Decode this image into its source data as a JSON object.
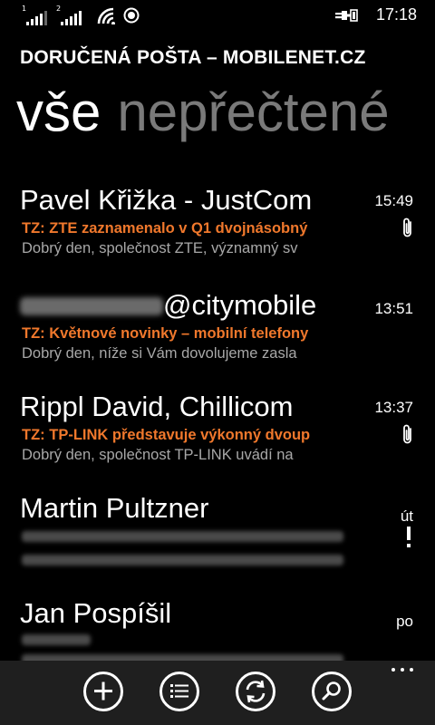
{
  "status_bar": {
    "sim1_label": "1",
    "sim2_label": "2",
    "time": "17:18",
    "icons": [
      "signal-bars-icon",
      "signal-bars-icon",
      "wifi-icon",
      "internet-sharing-icon",
      "battery-charging-icon"
    ]
  },
  "header": {
    "account_title": "DORUČENÁ POŠTA – MOBILENET.CZ",
    "pivot_active": "vše",
    "pivot_next": "nepřečtené"
  },
  "colors": {
    "accent": "#f0782c",
    "background": "#000000",
    "preview_text": "#a8a8a8",
    "inactive_pivot": "#7a7a7a",
    "app_bar": "#1f1f1f"
  },
  "messages": [
    {
      "sender": "Pavel Křižka - JustCom",
      "subject": "TZ: ZTE zaznamenalo v Q1 dvojnásobný",
      "preview": "Dobrý den, společnost ZTE, významný sv",
      "time": "15:49",
      "attachment": true,
      "flag": false
    },
    {
      "sender": "@citymobile",
      "subject": "TZ: Květnové novinky – mobilní telefony",
      "preview": "Dobrý den, níže si Vám dovolujeme zasla",
      "time": "13:51",
      "attachment": false,
      "flag": false
    },
    {
      "sender": "Rippl David, Chillicom",
      "subject": "TZ: TP-LINK představuje výkonný dvoup",
      "preview": "Dobrý den, společnost TP-LINK uvádí na",
      "time": "13:37",
      "attachment": true,
      "flag": false
    },
    {
      "sender": "Martin Pultzner",
      "time": "út",
      "attachment": false,
      "flag": true
    },
    {
      "sender": "Jan Pospíšil",
      "time": "po",
      "attachment": false,
      "flag": false
    }
  ],
  "app_bar": {
    "buttons": [
      "new-mail",
      "select",
      "sync",
      "search"
    ],
    "more_icon": "ellipsis-icon"
  }
}
